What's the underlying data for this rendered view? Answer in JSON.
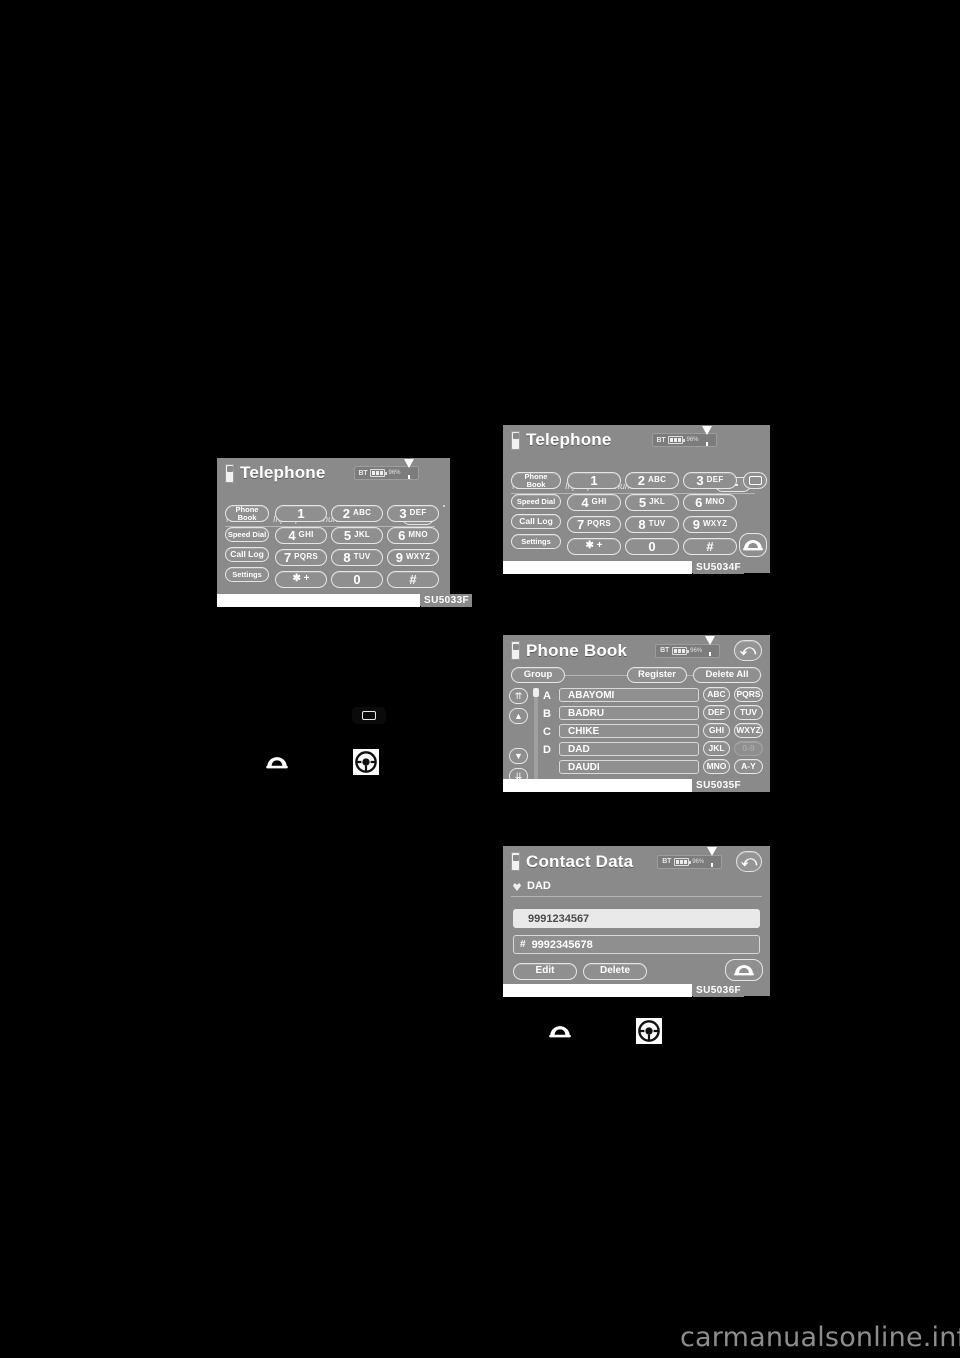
{
  "page": {
    "background": "#000000",
    "watermark": "carmanualsonline.info",
    "watermark_color": "#8d8d8d"
  },
  "colors": {
    "screen_bg": "#8a8a8a",
    "button_bg": "#8f8f8f",
    "button_border": "#e6e6e6",
    "text": "#ffffff",
    "code_bar": "#ffffff",
    "highlight_row": "#e9e9e9"
  },
  "status_bar": {
    "bluetooth_label": "BT",
    "battery_icon": "battery-icon",
    "percent_label": "96%",
    "signal_icon": "signal-antenna-icon"
  },
  "figures": [
    {
      "id": "telephone-1",
      "code": "SU5033F",
      "title": "Telephone",
      "title_icon": "mobile-phone-icon",
      "has_back_button": false,
      "input": {
        "number_label": "Number",
        "placeholder": "Input phone number",
        "backspace_icon": "backspace-icon"
      },
      "side_buttons": [
        {
          "label": "Phone\nBook",
          "name": "phone-book-button"
        },
        {
          "label": "Speed Dial",
          "name": "speed-dial-button"
        },
        {
          "label": "Call Log",
          "name": "call-log-button"
        },
        {
          "label": "Settings",
          "name": "settings-button"
        }
      ],
      "keypad": [
        {
          "digit": "1",
          "letters": ""
        },
        {
          "digit": "2",
          "letters": "ABC"
        },
        {
          "digit": "3",
          "letters": "DEF"
        },
        {
          "digit": "4",
          "letters": "GHI"
        },
        {
          "digit": "5",
          "letters": "JKL"
        },
        {
          "digit": "6",
          "letters": "MNO"
        },
        {
          "digit": "7",
          "letters": "PQRS"
        },
        {
          "digit": "8",
          "letters": "TUV"
        },
        {
          "digit": "9",
          "letters": "WXYZ"
        },
        {
          "digit": "✱  +",
          "letters": ""
        },
        {
          "digit": "0",
          "letters": ""
        },
        {
          "digit": "#",
          "letters": ""
        }
      ],
      "display_off_button": "display-off-icon",
      "call_button": "off-hook-call-icon"
    },
    {
      "id": "telephone-2",
      "code": "SU5034F",
      "title": "Telephone",
      "title_icon": "mobile-phone-icon",
      "has_back_button": false,
      "input": {
        "number_label": "Number",
        "placeholder": "Input phone number",
        "backspace_icon": "backspace-icon"
      },
      "side_buttons": [
        {
          "label": "Phone\nBook",
          "name": "phone-book-button"
        },
        {
          "label": "Speed Dial",
          "name": "speed-dial-button"
        },
        {
          "label": "Call Log",
          "name": "call-log-button"
        },
        {
          "label": "Settings",
          "name": "settings-button"
        }
      ],
      "keypad": [
        {
          "digit": "1",
          "letters": ""
        },
        {
          "digit": "2",
          "letters": "ABC"
        },
        {
          "digit": "3",
          "letters": "DEF"
        },
        {
          "digit": "4",
          "letters": "GHI"
        },
        {
          "digit": "5",
          "letters": "JKL"
        },
        {
          "digit": "6",
          "letters": "MNO"
        },
        {
          "digit": "7",
          "letters": "PQRS"
        },
        {
          "digit": "8",
          "letters": "TUV"
        },
        {
          "digit": "9",
          "letters": "WXYZ"
        },
        {
          "digit": "✱  +",
          "letters": ""
        },
        {
          "digit": "0",
          "letters": ""
        },
        {
          "digit": "#",
          "letters": ""
        }
      ],
      "display_off_button": "display-off-icon",
      "call_button": "off-hook-call-icon"
    },
    {
      "id": "phone-book",
      "code": "SU5035F",
      "title": "Phone Book",
      "title_icon": "mobile-phone-icon",
      "has_back_button": true,
      "back_icon": "back-arrow-icon",
      "toolbar": [
        {
          "label": "Group",
          "name": "group-button"
        },
        {
          "label": "Register",
          "name": "register-button"
        },
        {
          "label": "Delete All",
          "name": "delete-all-button"
        }
      ],
      "scroll_buttons": [
        {
          "icon": "scroll-top-icon",
          "glyph": "⏫"
        },
        {
          "icon": "scroll-up-icon",
          "glyph": "▲"
        },
        {
          "icon": "scroll-down-icon",
          "glyph": "▼"
        },
        {
          "icon": "scroll-bottom-icon",
          "glyph": "⏬"
        }
      ],
      "entries": [
        {
          "letter": "A",
          "name": "ABAYOMI"
        },
        {
          "letter": "B",
          "name": "BADRU"
        },
        {
          "letter": "C",
          "name": "CHIKE"
        },
        {
          "letter": "D",
          "name": "DAD"
        },
        {
          "letter": "",
          "name": "DAUDI"
        }
      ],
      "alpha_keys": [
        {
          "label": "ABC",
          "disabled": false
        },
        {
          "label": "PQRS",
          "disabled": false
        },
        {
          "label": "DEF",
          "disabled": false
        },
        {
          "label": "TUV",
          "disabled": false
        },
        {
          "label": "GHI",
          "disabled": false
        },
        {
          "label": "WXYZ",
          "disabled": false
        },
        {
          "label": "JKL",
          "disabled": false
        },
        {
          "label": "0-9",
          "disabled": true
        },
        {
          "label": "MNO",
          "disabled": false
        },
        {
          "label": "A-Y",
          "disabled": false
        }
      ]
    },
    {
      "id": "contact-data",
      "code": "SU5036F",
      "title": "Contact Data",
      "title_icon": "mobile-phone-icon",
      "has_back_button": true,
      "back_icon": "back-arrow-icon",
      "contact_name": "DAD",
      "contact_icon": "home-marker-icon",
      "numbers": [
        {
          "value": "9991234567",
          "tag": "",
          "highlighted": true
        },
        {
          "value": "9992345678",
          "tag": "#",
          "highlighted": false
        }
      ],
      "actions": [
        {
          "label": "Edit",
          "name": "edit-button"
        },
        {
          "label": "Delete",
          "name": "delete-button"
        }
      ],
      "call_button": "off-hook-call-icon"
    }
  ],
  "inline_icons": [
    {
      "name": "display-off-icon",
      "group": "left-column"
    },
    {
      "name": "off-hook-call-icon",
      "group": "left-column"
    },
    {
      "name": "steering-wheel-call-icon",
      "group": "left-column"
    },
    {
      "name": "off-hook-call-icon",
      "group": "right-column"
    },
    {
      "name": "steering-wheel-call-icon",
      "group": "right-column"
    }
  ]
}
